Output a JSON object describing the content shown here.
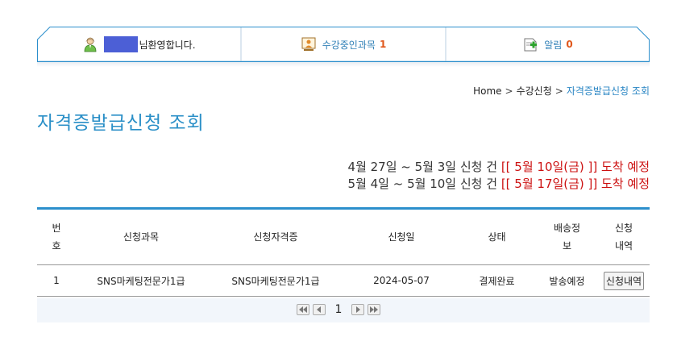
{
  "topbar": {
    "welcome_suffix": "님환영합니다.",
    "courses_label": "수강중인과목",
    "courses_count": "1",
    "alerts_label": "알림",
    "alerts_count": "0"
  },
  "breadcrumb": {
    "home": "Home",
    "sep": ">",
    "level1": "수강신청",
    "current": "자격증발급신청 조회"
  },
  "title": "자격증발급신청 조회",
  "notices": [
    {
      "period": "4월 27일 ~ 5월 3일 신청 건",
      "arrival": "[[ 5월 10일(금) ]] 도착 예정"
    },
    {
      "period": "5월 4일 ~ 5월 10일 신청 건",
      "arrival": "[[ 5월 17일(금) ]] 도착 예정"
    }
  ],
  "table": {
    "headers": {
      "no_line1": "번",
      "no_line2": "호",
      "course": "신청과목",
      "cert": "신청자격증",
      "date": "신청일",
      "status": "상태",
      "ship_line1": "배송정",
      "ship_line2": "보",
      "detail_line1": "신청",
      "detail_line2": "내역"
    },
    "rows": [
      {
        "no": "1",
        "course": "SNS마케팅전문가1급",
        "cert": "SNS마케팅전문가1급",
        "date": "2024-05-07",
        "status": "결제완료",
        "shipping": "발송예정",
        "detail_button": "신청내역"
      }
    ]
  },
  "pagination": {
    "current_page": "1"
  },
  "colors": {
    "accent_blue": "#2a8fc7",
    "user_block": "#4c5fd6",
    "count_orange": "#e0571b",
    "alert_red": "#cc1111",
    "status_navy": "#1d2a9a"
  },
  "icons": [
    "user-icon",
    "course-icon",
    "alert-icon",
    "first-page-icon",
    "prev-page-icon",
    "next-page-icon",
    "last-page-icon"
  ]
}
